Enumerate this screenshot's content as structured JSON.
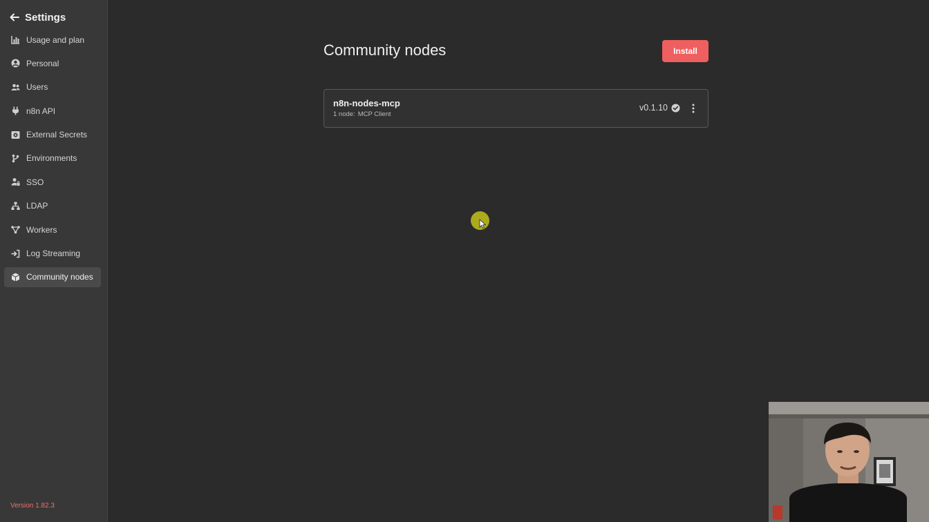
{
  "sidebar": {
    "title": "Settings",
    "back_icon": "arrow-left-icon",
    "items": [
      {
        "label": "Usage and plan",
        "icon": "bar-chart-icon",
        "active": false
      },
      {
        "label": "Personal",
        "icon": "user-circle-icon",
        "active": false
      },
      {
        "label": "Users",
        "icon": "users-icon",
        "active": false
      },
      {
        "label": "n8n API",
        "icon": "plug-icon",
        "active": false
      },
      {
        "label": "External Secrets",
        "icon": "vault-icon",
        "active": false
      },
      {
        "label": "Environments",
        "icon": "git-branch-icon",
        "active": false
      },
      {
        "label": "SSO",
        "icon": "user-lock-icon",
        "active": false
      },
      {
        "label": "LDAP",
        "icon": "network-icon",
        "active": false
      },
      {
        "label": "Workers",
        "icon": "nodes-icon",
        "active": false
      },
      {
        "label": "Log Streaming",
        "icon": "sign-in-icon",
        "active": false
      },
      {
        "label": "Community nodes",
        "icon": "cube-icon",
        "active": true
      }
    ],
    "version": "Version 1.82.3"
  },
  "main": {
    "title": "Community nodes",
    "install_label": "Install",
    "packages": [
      {
        "name": "n8n-nodes-mcp",
        "count_label": "1 node:",
        "nodes": "MCP Client",
        "version": "v0.1.10",
        "verified_icon": "check-circle-icon",
        "menu_icon": "vertical-dots-icon"
      }
    ]
  },
  "colors": {
    "background": "#2b2b2b",
    "sidebar": "#383838",
    "accent": "#ef5f5f",
    "version_text": "#f06e6e",
    "cursor_highlight": "#b7b51c"
  }
}
